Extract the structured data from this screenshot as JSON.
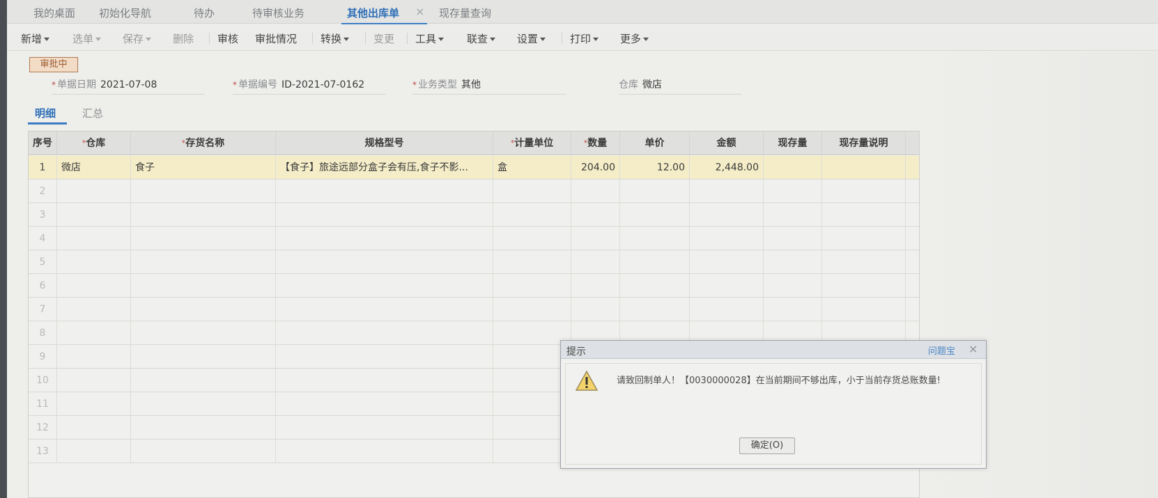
{
  "tabs": [
    "我的桌面",
    "初始化导航",
    "待办",
    "待审核业务",
    "其他出库单",
    "现存量查询"
  ],
  "active_tab_close": "×",
  "toolbar": {
    "items": [
      "新增",
      "选单",
      "保存",
      "删除",
      "审核",
      "审批情况",
      "转换",
      "变更",
      "工具",
      "联查",
      "设置",
      "打印",
      "更多"
    ]
  },
  "status_badge": "审批中",
  "header": {
    "date_label": "单据日期",
    "date_value": "2021-07-08",
    "code_label": "单据编号",
    "code_value": "ID-2021-07-0162",
    "biz_type_label": "业务类型",
    "biz_type_value": "其他",
    "warehouse_label": "仓库",
    "warehouse_value": "微店"
  },
  "subtabs": [
    "明细",
    "汇总"
  ],
  "table": {
    "columns": [
      "序号",
      "仓库",
      "存货名称",
      "规格型号",
      "计量单位",
      "数量",
      "单价",
      "金额",
      "现存量",
      "现存量说明"
    ],
    "rows": [
      [
        "1",
        "微店",
        "食子",
        "【食子】旅途远部分盒子会有压,食子不影...",
        "盒",
        "204.00",
        "12.00",
        "2,448.00",
        "",
        ""
      ]
    ],
    "empty_row_numbers": [
      "2",
      "3",
      "4",
      "5",
      "6",
      "7",
      "8",
      "9",
      "10",
      "11",
      "12",
      "13"
    ]
  },
  "dialog": {
    "title": "提示",
    "help_link": "问题宝",
    "close": "×",
    "message": "请致回制单人！【0030000028】在当前期间不够出库，小于当前存货总账数量!",
    "ok_button": "确定(O)"
  }
}
